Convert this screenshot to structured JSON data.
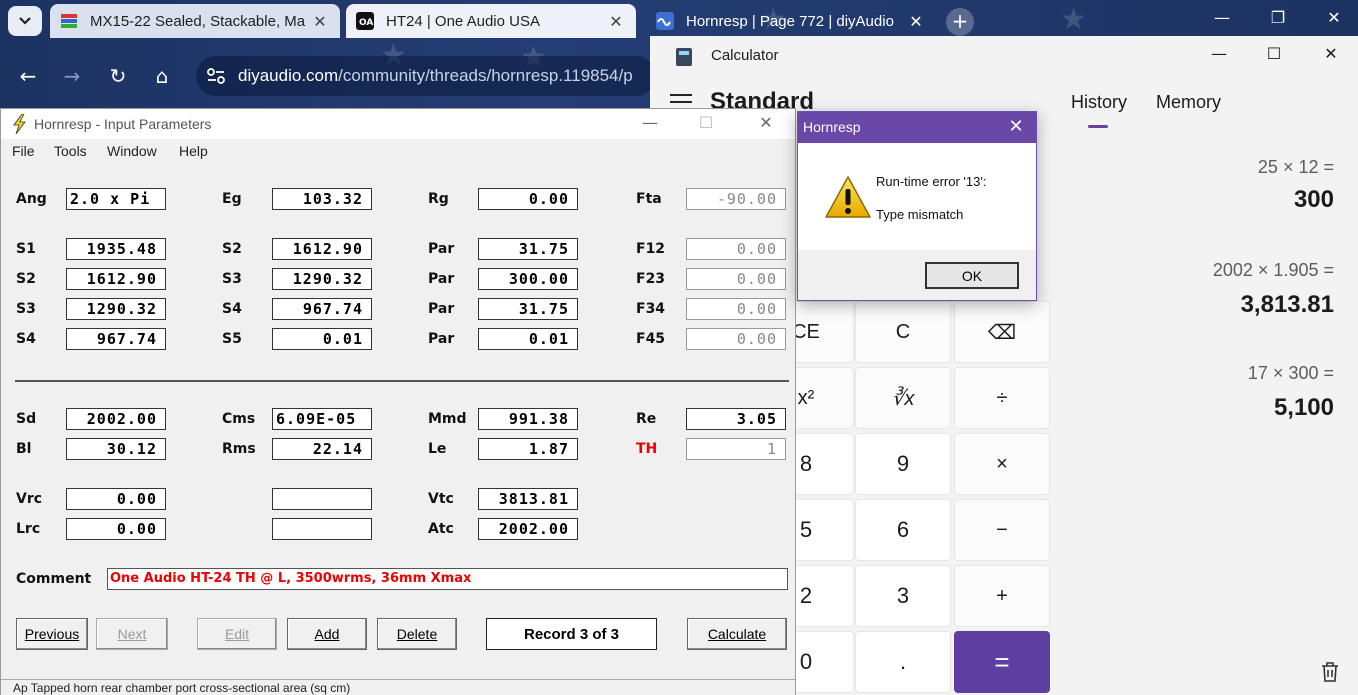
{
  "browser": {
    "tabs": [
      {
        "title": "MX15-22 Sealed, Stackable, Ma",
        "icon": "flag-icon"
      },
      {
        "title": "HT24 | One Audio USA",
        "icon": "oa-logo-icon"
      },
      {
        "title": "Hornresp | Page 772 | diyAudio",
        "icon": "diyaudio-icon"
      }
    ],
    "url_host": "diyaudio.com",
    "url_path": "/community/threads/hornresp.119854/p"
  },
  "calculator": {
    "title": "Calculator",
    "mode": "Standard",
    "tabs": {
      "history": "History",
      "memory": "Memory"
    },
    "history": [
      {
        "expression": "25  ×  12 =",
        "result": "300"
      },
      {
        "expression": "2002  ×  1.905 =",
        "result": "3,813.81"
      },
      {
        "expression": "17  ×  300 =",
        "result": "5,100"
      }
    ],
    "keys": {
      "ce": "CE",
      "c": "C",
      "backspace": "⌫",
      "square": "x²",
      "cube_root": "∛x",
      "divide": "÷",
      "eight": "8",
      "nine": "9",
      "multiply": "×",
      "five": "5",
      "six": "6",
      "minus": "−",
      "two": "2",
      "three": "3",
      "plus": "+",
      "zero": "0",
      "decimal": ".",
      "equals": "="
    },
    "accent": "#5e3ea1"
  },
  "hornresp": {
    "title": "Hornresp - Input Parameters",
    "menu": [
      "File",
      "Tools",
      "Window",
      "Help"
    ],
    "labels": {
      "ang": "Ang",
      "eg": "Eg",
      "rg": "Rg",
      "fta": "Fta",
      "s1": "S1",
      "s2a": "S2",
      "par1": "Par",
      "f12": "F12",
      "s2b": "S2",
      "s3a": "S3",
      "par2": "Par",
      "f23": "F23",
      "s3b": "S3",
      "s4a": "S4",
      "par3": "Par",
      "f34": "F34",
      "s4b": "S4",
      "s5": "S5",
      "par4": "Par",
      "f45": "F45",
      "sd": "Sd",
      "cms": "Cms",
      "mmd": "Mmd",
      "re": "Re",
      "bl": "Bl",
      "rms": "Rms",
      "le": "Le",
      "th": "TH",
      "vrc": "Vrc",
      "vtc": "Vtc",
      "lrc": "Lrc",
      "atc": "Atc",
      "comment": "Comment"
    },
    "values": {
      "ang": "2.0 x Pi",
      "eg": "103.32",
      "rg": "0.00",
      "fta": "-90.00",
      "s1": "1935.48",
      "s2a": "1612.90",
      "par1": "31.75",
      "f12": "0.00",
      "s2b": "1612.90",
      "s3a": "1290.32",
      "par2": "300.00",
      "f23": "0.00",
      "s3b": "1290.32",
      "s4a": "967.74",
      "par3": "31.75",
      "f34": "0.00",
      "s4b": "967.74",
      "s5": "0.01",
      "par4": "0.01",
      "f45": "0.00",
      "sd": "2002.00",
      "cms": "6.09E-05",
      "mmd": "991.38",
      "re": "3.05",
      "bl": "30.12",
      "rms": "22.14",
      "le": "1.87",
      "th": "1",
      "vrc": "0.00",
      "blank1": "",
      "vtc": "3813.81",
      "lrc": "0.00",
      "blank2": "",
      "atc": "2002.00"
    },
    "comment": "One Audio HT-24 TH @ L, 3500wrms, 36mm Xmax",
    "buttons": {
      "previous": "Previous",
      "next": "Next",
      "edit": "Edit",
      "add": "Add",
      "delete": "Delete",
      "calculate": "Calculate"
    },
    "record": "Record 3 of 3",
    "status": "Ap   Tapped horn rear chamber port cross-sectional area  (sq cm)"
  },
  "dialog": {
    "title": "Hornresp",
    "message_line1": "Run-time error '13':",
    "message_line2": "Type mismatch",
    "ok": "OK",
    "icon": "warning-icon"
  }
}
